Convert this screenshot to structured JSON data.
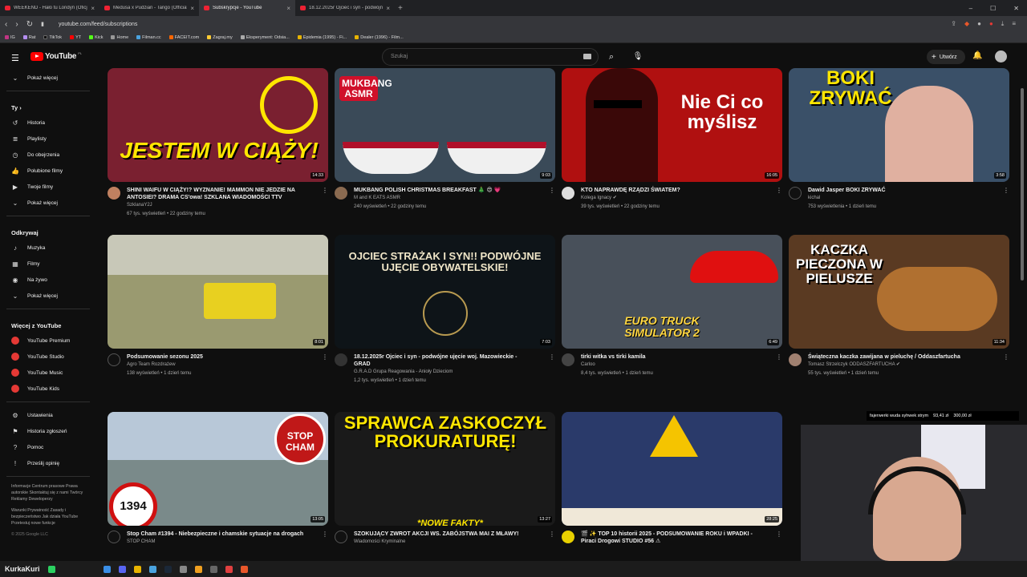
{
  "browser": {
    "tabs": [
      {
        "label": "WEEKEND - Hało tu Londyn (Oficjaln"
      },
      {
        "label": "Medusa x Pudzian - Tango (Official V"
      },
      {
        "label": "Subskrypcje - YouTube",
        "active": true
      },
      {
        "label": "18.12.2025r Ojciec i syn - podwójne"
      }
    ],
    "url": "youtube.com/feed/subscriptions",
    "bookmarks": [
      "IG",
      "Rat",
      "TikTok",
      "YT",
      "Kick",
      "Home",
      "Filman.cc",
      "FACEIT.com",
      "Zagraj.my",
      "Eksperyment: Odsia...",
      "Epidemia (1995) - Fi...",
      "Dealer (1996) - Film..."
    ]
  },
  "header": {
    "logo": "YouTube",
    "region": "PL",
    "search_placeholder": "Szukaj",
    "create_label": "Utwórz"
  },
  "sidebar": {
    "top": [
      {
        "label": "Pokaż więcej",
        "icon": "chevron-down-icon"
      }
    ],
    "you_heading": "Ty",
    "you": [
      {
        "label": "Historia",
        "icon": "history-icon"
      },
      {
        "label": "Playlisty",
        "icon": "playlist-icon"
      },
      {
        "label": "Do obejrzenia",
        "icon": "clock-icon"
      },
      {
        "label": "Polubione filmy",
        "icon": "like-icon"
      },
      {
        "label": "Twoje filmy",
        "icon": "video-icon"
      },
      {
        "label": "Pokaż więcej",
        "icon": "chevron-down-icon"
      }
    ],
    "explore_heading": "Odkrywaj",
    "explore": [
      {
        "label": "Muzyka",
        "icon": "music-icon"
      },
      {
        "label": "Filmy",
        "icon": "film-icon"
      },
      {
        "label": "Na żywo",
        "icon": "live-icon"
      },
      {
        "label": "Pokaż więcej",
        "icon": "chevron-down-icon"
      }
    ],
    "more_heading": "Więcej z YouTube",
    "more": [
      {
        "label": "YouTube Premium"
      },
      {
        "label": "YouTube Studio"
      },
      {
        "label": "YouTube Music"
      },
      {
        "label": "YouTube Kids"
      }
    ],
    "settings": [
      {
        "label": "Ustawienia",
        "icon": "gear-icon"
      },
      {
        "label": "Historia zgłoszeń",
        "icon": "flag-icon"
      },
      {
        "label": "Pomoc",
        "icon": "help-icon"
      },
      {
        "label": "Prześlij opinię",
        "icon": "feedback-icon"
      }
    ],
    "footer1": "Informacje Centrum prasowe Prawa autorskie Skontaktuj się z nami Twórcy Reklamy Deweloperzy",
    "footer2": "Warunki Prywatność Zasady i bezpieczeństwo Jak działa YouTube Przetestuj nowe funkcje",
    "copyright": "© 2025 Google LLC"
  },
  "videos": [
    {
      "title": "SHINI WAIFU W CIĄŻY!? WYZNANIE! MAMMON NIE JEDZIE NA ANTOSIEI? DRAMA CS'owa! SZKLANA WIADOMOŚCI TTV",
      "channel": "SzklanaY2J",
      "stats": "67 tys. wyświetleń • 22 godziny temu",
      "duration": "14:33",
      "overlay": "JESTEM W CIĄŻY!",
      "bg": "#7a2030",
      "color": "#ffe600"
    },
    {
      "title": "MUKBANG POLISH CHRISTMAS BREAKFAST 🎄 😍 💗",
      "channel": "M and K EATS ASMR",
      "stats": "240 wyświetleń • 22 godziny temu",
      "duration": "9:03",
      "overlay": "MUKBANG ASMR",
      "bg": "#3a4a58",
      "color": "#ffffff"
    },
    {
      "title": "KTO NAPRAWDĘ RZĄDZI ŚWIATEM?",
      "channel": "Kolega Ignacy ✔",
      "stats": "39 tys. wyświetleń • 22 godziny temu",
      "duration": "16:05",
      "overlay": "Nie Ci co myślisz",
      "bg": "#b01010",
      "color": "#ffffff"
    },
    {
      "title": "Dawid Jasper BOKI ZRYWAĆ",
      "channel": "kichal",
      "stats": "753 wyświetlenia • 1 dzień temu",
      "duration": "3:58",
      "overlay": "BOKI ZRYWAĆ",
      "bg": "#3a5068",
      "color": "#ffe600"
    },
    {
      "title": "Podsumowanie sezonu 2025",
      "channel": "Agro Team Rozdrażew",
      "stats": "138 wyświetleń • 1 dzień temu",
      "duration": "8:01",
      "overlay": "",
      "bg": "#9a9a70",
      "color": "#ffffff"
    },
    {
      "title": "18.12.2025r Ojciec i syn - podwójne ujęcie woj. Mazowieckie - GRAD",
      "channel": "G.R.A.D Grupa Reagowania - Anioły Dzieciom",
      "stats": "1,2 tys. wyświetleń • 1 dzień temu",
      "duration": "7:03",
      "overlay": "OJCIEC STRAŻAK I SYN!! PODWÓJNE UJĘCIE OBYWATELSKIE!",
      "bg": "#0e1418",
      "color": "#f0e6c8"
    },
    {
      "title": "tirki witka vs tirki kamila",
      "channel": "Carloo",
      "stats": "8,4 tys. wyświetleń • 1 dzień temu",
      "duration": "6:49",
      "overlay": "EURO TRUCK SIMULATOR 2",
      "bg": "#48505a",
      "color": "#ffd640"
    },
    {
      "title": "Świąteczna kaczka zawijana w pieluchę / Oddaszfartucha",
      "channel": "Tomasz Strzelczyk ODDASZFARTUCHA ✔",
      "stats": "55 tys. wyświetleń • 1 dzień temu",
      "duration": "11:34",
      "overlay": "KACZKA PIECZONA W PIELUSZE",
      "bg": "#5a3a22",
      "color": "#ffffff"
    },
    {
      "title": "Stop Cham #1394 - Niebezpieczne i chamskie sytuacje na drogach",
      "channel": "STOP CHAM",
      "stats": "",
      "duration": "13:05",
      "overlay": "1394",
      "bg": "#7a8a8a",
      "color": "#111111"
    },
    {
      "title": "SZOKUJĄCY ZWROT AKCJI WS. ZABÓJSTWA MAI Z MŁAWY!",
      "channel": "Wiadomości Kryminalne",
      "stats": "",
      "duration": "13:27",
      "overlay": "SPRAWCA ZASKOCZYŁ PROKURATURĘ!",
      "bg": "#1a1a1a",
      "color": "#ffe600"
    },
    {
      "title": "🎬 ✨ TOP 10 historii 2025 - PODSUMOWANIE ROKU i WPADKI - Piraci Drogowi STUDIO #56 ⚠",
      "channel": "",
      "stats": "",
      "duration": "28:25",
      "overlay": "",
      "bg": "#2a3a6a",
      "color": "#ffffff"
    }
  ],
  "stream": {
    "ticker_a": "fajerwerki wuda syhwek strym",
    "ticker_b": "93,41 zł",
    "ticker_c": "300,00 zł",
    "watermark": "KurkaKuri"
  }
}
